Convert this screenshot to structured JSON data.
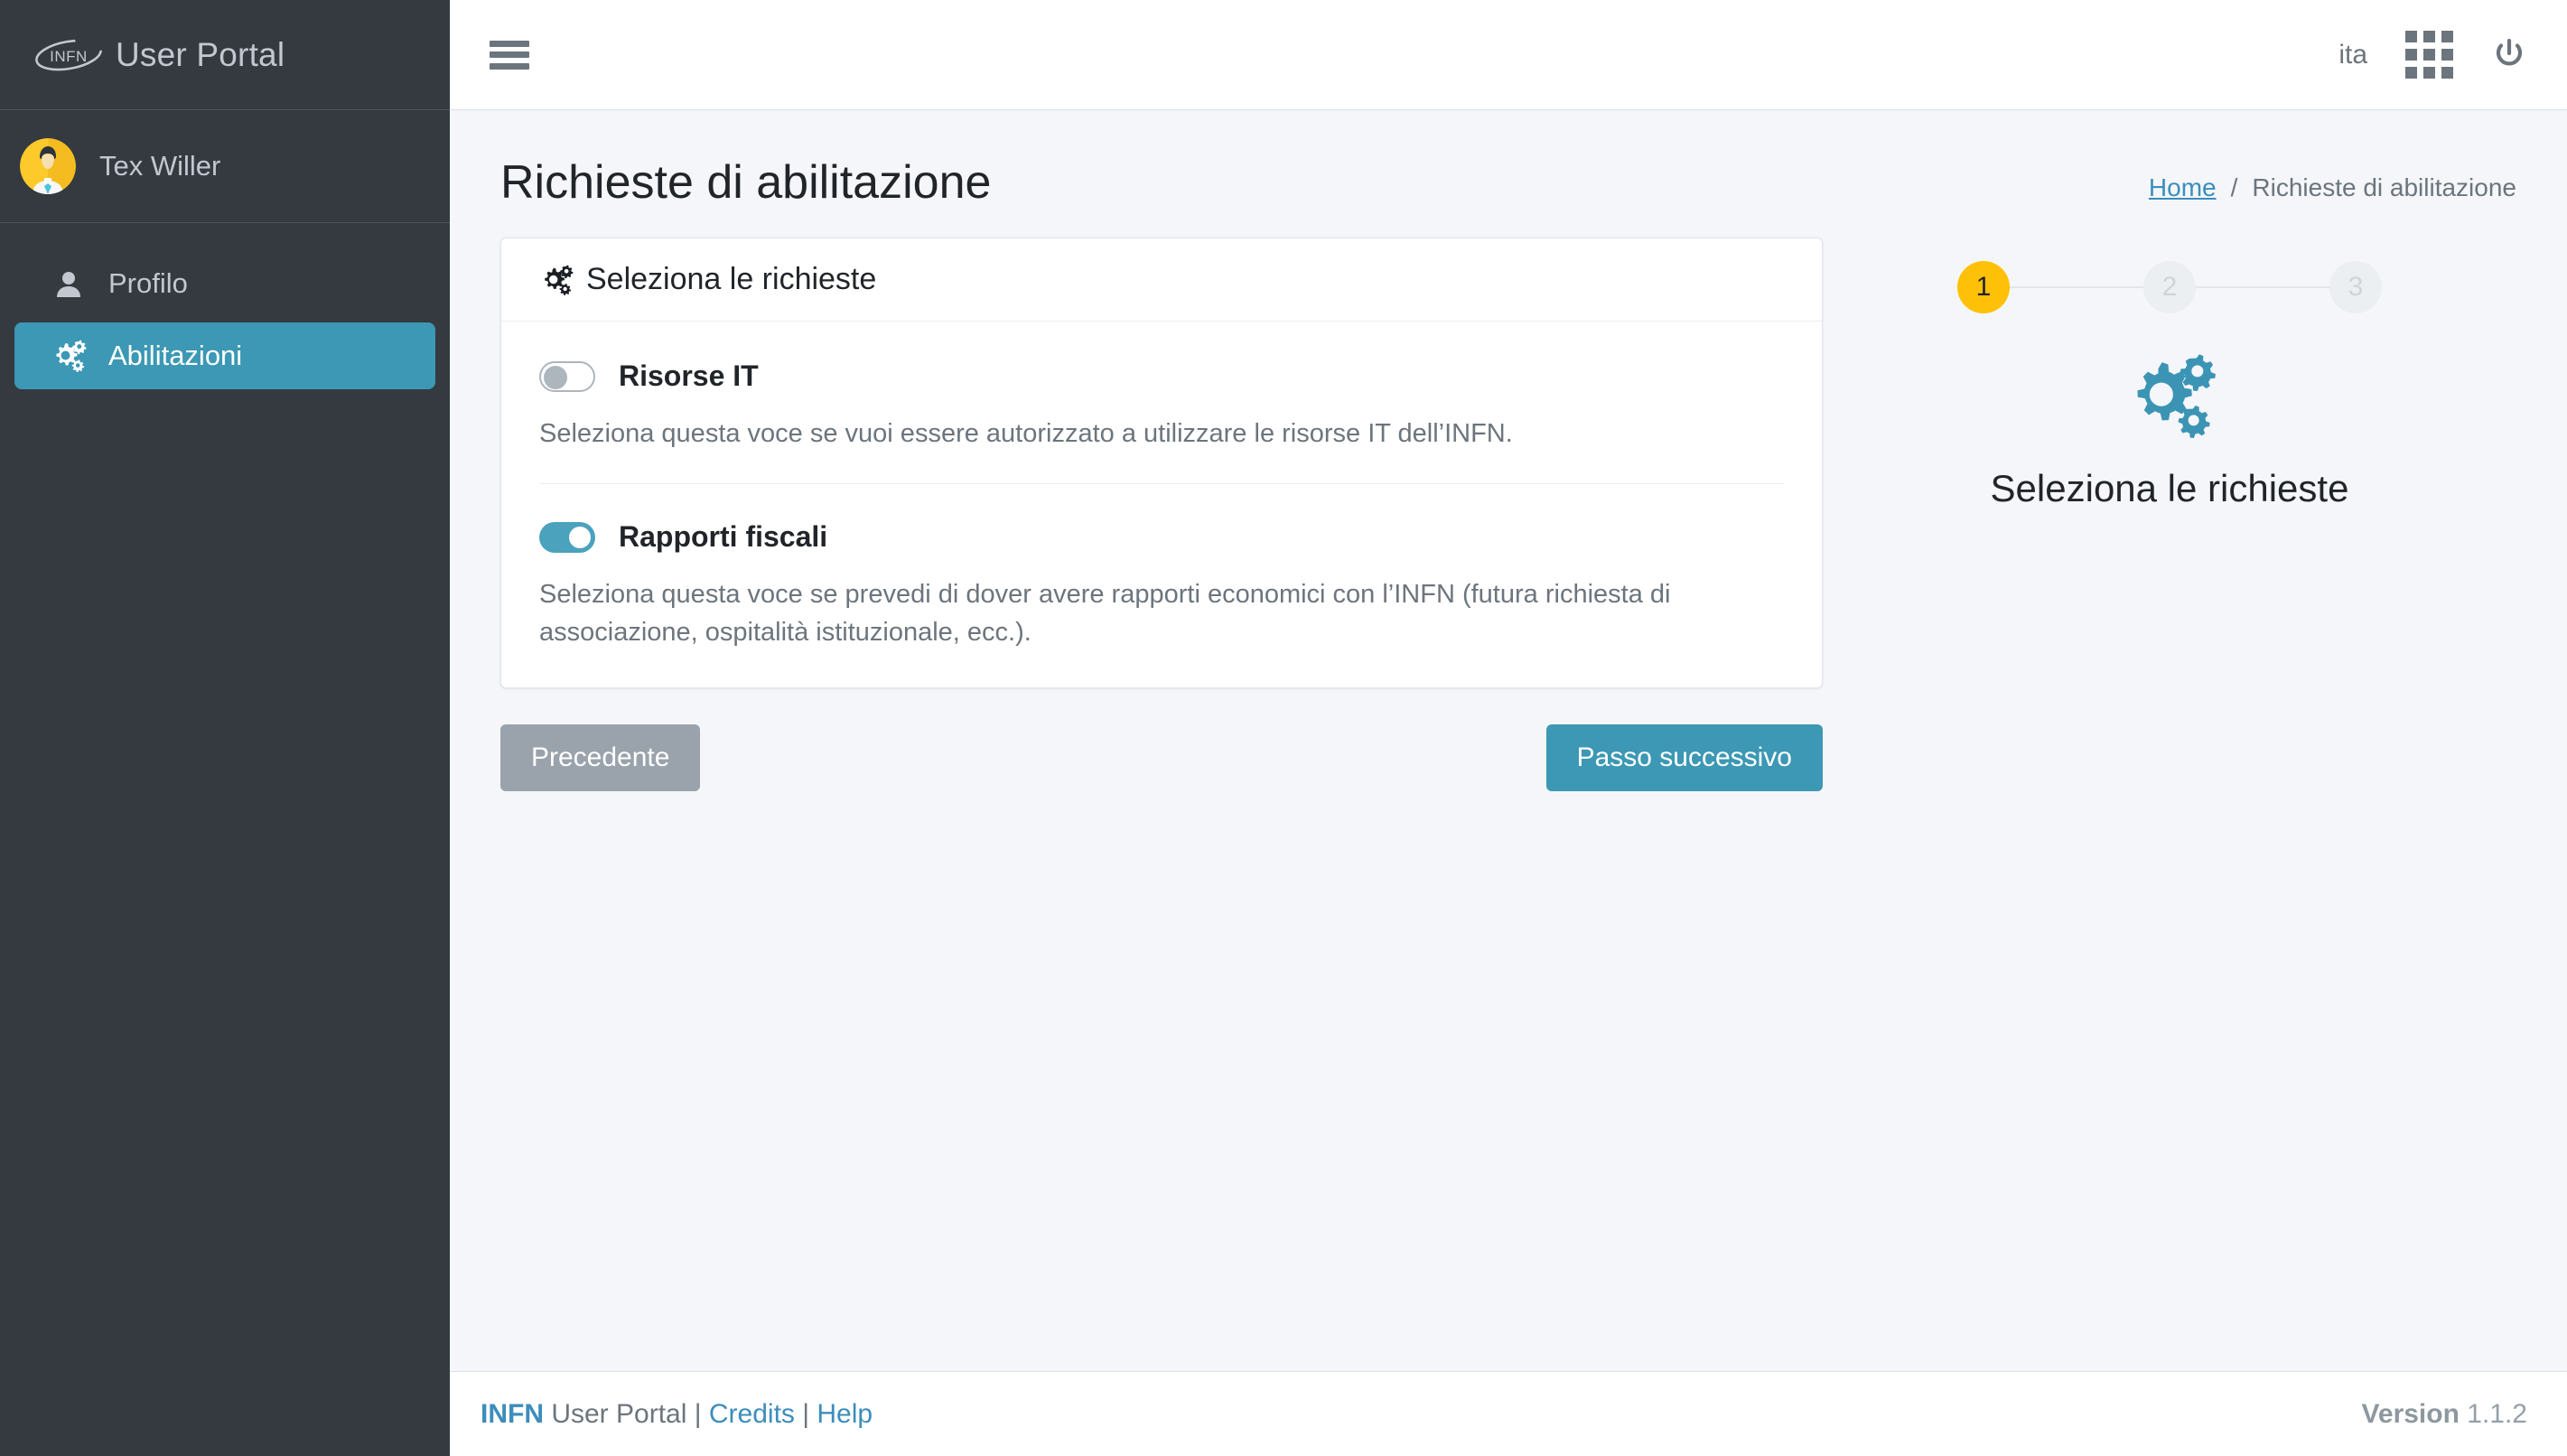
{
  "sidebar": {
    "brand": {
      "logo_text": "INFN",
      "title": "User Portal"
    },
    "user": {
      "name": "Tex Willer",
      "avatar_icon": "user-avatar-illustration"
    },
    "items": [
      {
        "label": "Profilo",
        "icon": "user-icon",
        "active": false
      },
      {
        "label": "Abilitazioni",
        "icon": "cogs-icon",
        "active": true
      }
    ]
  },
  "navbar": {
    "menu_icon": "hamburger-icon",
    "language": "ita",
    "apps_icon": "grid-apps-icon",
    "power_icon": "power-off-icon"
  },
  "content": {
    "page_title": "Richieste di abilitazione",
    "breadcrumb": {
      "home": "Home",
      "separator": "/",
      "current": "Richieste di abilitazione"
    },
    "card": {
      "header_icon": "cogs-icon",
      "header_title": "Seleziona le richieste",
      "options": [
        {
          "label": "Risorse IT",
          "state": "off",
          "description": "Seleziona questa voce se vuoi essere autorizzato a utilizzare le risorse IT dell’INFN."
        },
        {
          "label": "Rapporti fiscali",
          "state": "on",
          "description": "Seleziona questa voce se prevedi di dover avere rapporti economici con l’INFN (futura richiesta di associazione, ospitalità istituzionale, ecc.)."
        }
      ]
    },
    "buttons": {
      "previous": "Precedente",
      "next": "Passo successivo"
    },
    "wizard": {
      "steps": [
        {
          "number": "1",
          "state": "active"
        },
        {
          "number": "2",
          "state": "inactive"
        },
        {
          "number": "3",
          "state": "inactive"
        }
      ],
      "icon": "cogs-icon",
      "title": "Seleziona le richieste"
    }
  },
  "footer": {
    "brand_bold": "INFN",
    "brand_rest": " User Portal",
    "sep1": "|",
    "credits": "Credits",
    "sep2": "|",
    "help": "Help",
    "version_label": "Version",
    "version_number": "1.1.2"
  },
  "colors": {
    "sidebar_bg": "#343a40",
    "accent_teal": "#3c98b4",
    "link_blue": "#3c8dbc",
    "step_active": "#ffc107",
    "muted_gray": "#6c757d"
  }
}
